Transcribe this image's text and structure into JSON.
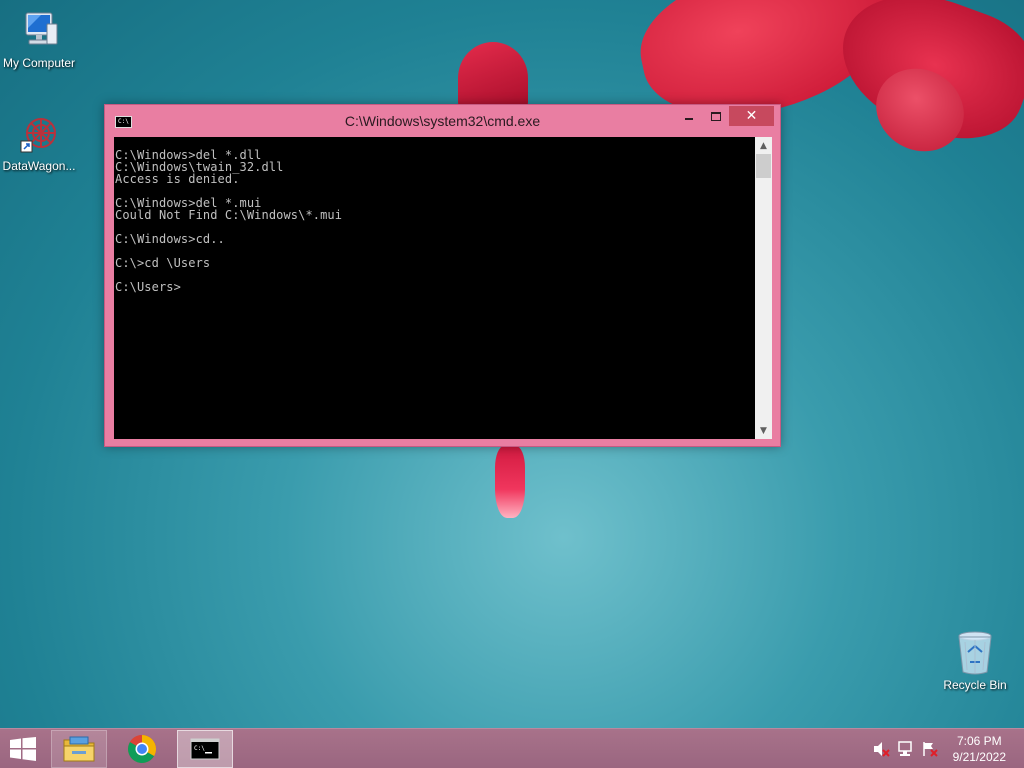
{
  "desktop": {
    "icons": [
      {
        "label": "My Computer",
        "icon": "computer-icon"
      },
      {
        "label": "DataWagon...",
        "icon": "datawagon-shortcut-icon"
      },
      {
        "label": "Recycle Bin",
        "icon": "recycle-bin-icon"
      }
    ]
  },
  "cmd_window": {
    "title": "C:\\Windows\\system32\\cmd.exe",
    "icon_text": "C:\\",
    "buttons": {
      "minimize": "minimize-icon",
      "maximize": "maximize-icon",
      "close": "✕"
    },
    "lines": [
      "C:\\Windows>del *.dll",
      "C:\\Windows\\twain_32.dll",
      "Access is denied.",
      "",
      "C:\\Windows>del *.mui",
      "Could Not Find C:\\Windows\\*.mui",
      "",
      "C:\\Windows>cd..",
      "",
      "C:\\>cd \\Users",
      "",
      "C:\\Users>"
    ]
  },
  "taskbar": {
    "items": [
      {
        "name": "file-explorer",
        "icon": "folder-icon"
      },
      {
        "name": "chrome",
        "icon": "chrome-icon"
      },
      {
        "name": "command-prompt",
        "icon": "cmd-icon"
      }
    ],
    "clock": {
      "time": "7:06 PM",
      "date": "9/21/2022"
    }
  },
  "colors": {
    "window_frame": "#e97ea2",
    "close_button": "#c7495e",
    "console_bg": "#000000",
    "console_text": "#c0c0c0",
    "taskbar": "#a8728a"
  }
}
